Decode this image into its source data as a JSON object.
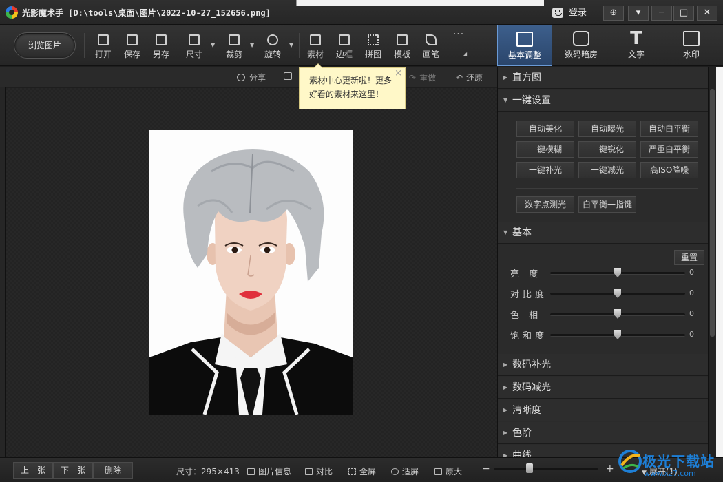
{
  "window": {
    "title": "光影魔术手 [D:\\tools\\桌面\\图片\\2022-10-27_152656.png]",
    "login_label": "登录",
    "controls": [
      "⊕",
      "▾",
      "─",
      "□",
      "✕"
    ]
  },
  "toolbar": {
    "browse_label": "浏览图片",
    "tools": [
      {
        "label": "打开",
        "icon": "open-image-icon"
      },
      {
        "label": "保存",
        "icon": "save-icon"
      },
      {
        "label": "另存",
        "icon": "save-as-icon"
      },
      {
        "label": "尺寸",
        "icon": "resize-icon"
      },
      {
        "label": "裁剪",
        "icon": "crop-icon"
      },
      {
        "label": "旋转",
        "icon": "rotate-icon"
      },
      {
        "label": "素材",
        "icon": "material-icon"
      },
      {
        "label": "边框",
        "icon": "border-icon"
      },
      {
        "label": "拼图",
        "icon": "collage-icon"
      },
      {
        "label": "模板",
        "icon": "template-icon"
      },
      {
        "label": "画笔",
        "icon": "brush-icon"
      },
      {
        "label": "···",
        "icon": "more-icon"
      }
    ]
  },
  "right_tabs": [
    {
      "label": "基本调整",
      "active": true
    },
    {
      "label": "数码暗房",
      "active": false
    },
    {
      "label": "文字",
      "active": false
    },
    {
      "label": "水印",
      "active": false
    }
  ],
  "subbar": {
    "share": "分享",
    "redo": "重做",
    "undo": "还原"
  },
  "tooltip": {
    "line1": "素材中心更新啦！更多",
    "line2": "好看的素材来这里！",
    "close": "×"
  },
  "panel": {
    "histogram": "直方图",
    "one_click": "一键设置",
    "one_click_buttons": [
      "自动美化",
      "自动曝光",
      "自动白平衡",
      "一键模糊",
      "一键锐化",
      "严重白平衡",
      "一键补光",
      "一键减光",
      "高ISO降噪"
    ],
    "extra_buttons": [
      "数字点测光",
      "白平衡一指键"
    ],
    "basic": "基本",
    "reset": "重置",
    "sliders": [
      {
        "label": "亮  度",
        "value": "0"
      },
      {
        "label": "对比度",
        "value": "0"
      },
      {
        "label": "色  相",
        "value": "0"
      },
      {
        "label": "饱和度",
        "value": "0"
      }
    ],
    "sections": [
      "数码补光",
      "数码减光",
      "清晰度",
      "色阶",
      "曲线"
    ]
  },
  "status": {
    "prev": "上一张",
    "next": "下一张",
    "delete": "删除",
    "size": "尺寸：295×413",
    "info": "图片信息",
    "compare": "对比",
    "fullscreen": "全屏",
    "fit": "适屏",
    "original": "原大",
    "minus": "−",
    "plus": "+",
    "expand": "展开(1)"
  },
  "watermark": {
    "text": "极光下载站",
    "sub": "www.xz7.com"
  }
}
